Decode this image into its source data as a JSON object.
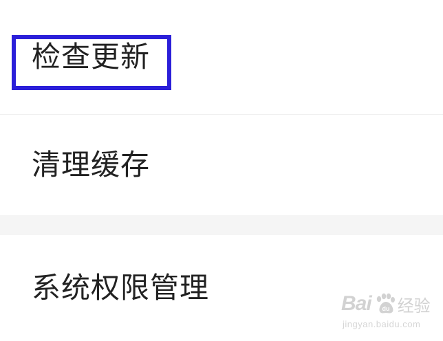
{
  "settings": {
    "items": [
      {
        "label": "检查更新"
      },
      {
        "label": "清理缓存"
      },
      {
        "label": "系统权限管理"
      }
    ]
  },
  "annotation": {
    "highlight_color": "#2b1fd9"
  },
  "watermark": {
    "brand_text": "Bai",
    "brand_suffix": "经验",
    "url": "jingyan.baidu.com",
    "icon": "baidu-paw-icon"
  },
  "colors": {
    "text": "#222222",
    "background": "#ffffff",
    "section_gap": "#f5f5f5"
  }
}
